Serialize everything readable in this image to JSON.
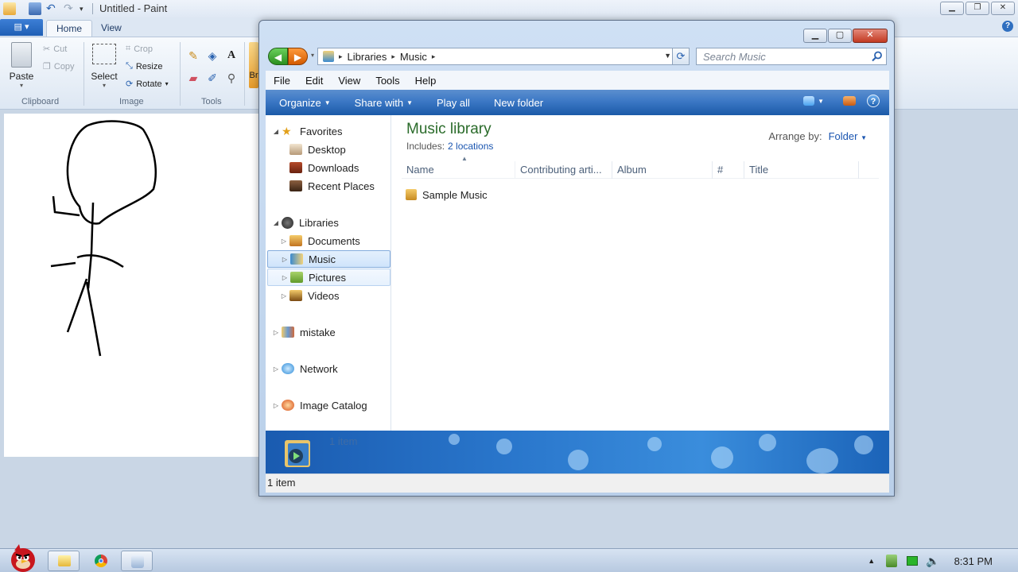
{
  "paint": {
    "title": "Untitled - Paint",
    "menu_button_glyph": "▤ ▾",
    "tabs": [
      {
        "label": "Home"
      },
      {
        "label": "View"
      }
    ],
    "clipboard": {
      "paste": "Paste",
      "cut": "Cut",
      "copy": "Copy",
      "group": "Clipboard"
    },
    "image": {
      "select": "Select",
      "crop": "Crop",
      "resize": "Resize",
      "rotate": "Rotate",
      "group": "Image"
    },
    "tools": {
      "group": "Tools",
      "text_glyph": "A"
    },
    "brushes_partial": "Br"
  },
  "explorer": {
    "address": {
      "segments": [
        "Libraries",
        "Music"
      ]
    },
    "search": {
      "placeholder": "Search Music"
    },
    "menu": [
      "File",
      "Edit",
      "View",
      "Tools",
      "Help"
    ],
    "commands": {
      "organize": "Organize",
      "share": "Share with",
      "play_all": "Play all",
      "new_folder": "New folder"
    },
    "nav": {
      "favorites": "Favorites",
      "desktop": "Desktop",
      "downloads": "Downloads",
      "recent": "Recent Places",
      "libraries": "Libraries",
      "documents": "Documents",
      "music": "Music",
      "pictures": "Pictures",
      "videos": "Videos",
      "mistake": "mistake",
      "network": "Network",
      "image_catalog": "Image Catalog"
    },
    "library": {
      "title": "Music library",
      "includes_label": "Includes:",
      "locations": "2 locations",
      "arrange_label": "Arrange by:",
      "arrange_value": "Folder"
    },
    "columns": [
      "Name",
      "Contributing arti...",
      "Album",
      "#",
      "Title"
    ],
    "items": [
      {
        "name": "Sample Music"
      }
    ],
    "details_text": "1 item",
    "status_text": "1 item"
  },
  "taskbar": {
    "clock": "8:31 PM"
  },
  "colors": {
    "accent": "#1a55b0",
    "library_title": "#2a6b2a",
    "command_bar": "#3c78c5"
  }
}
